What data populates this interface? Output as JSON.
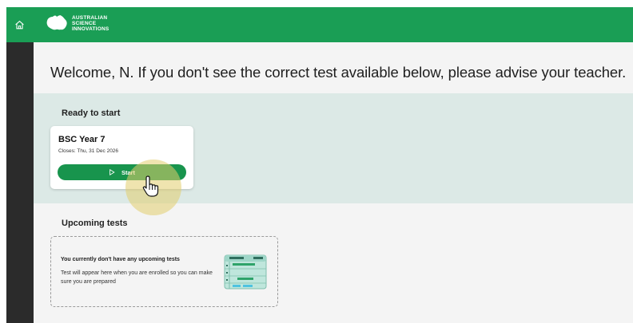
{
  "header": {
    "logo_text": "AUSTRALIAN\nSCIENCE\nINNOVATIONS",
    "brand_color": "#1a9e55",
    "home_icon": "home-icon"
  },
  "main": {
    "welcome": "Welcome, N. If you don't see the correct test available below, please advise your teacher."
  },
  "ready": {
    "title": "Ready to start",
    "card": {
      "title": "BSC Year 7",
      "closes": "Closes: Thu, 31 Dec 2026",
      "start_label": "Start",
      "start_icon": "play-icon"
    }
  },
  "upcoming": {
    "title": "Upcoming tests",
    "empty_title": "You currently don't have any upcoming tests",
    "empty_desc": "Test will appear here when you are enrolled so you can make sure you are prepared"
  },
  "colors": {
    "band": "#dce9e6",
    "button": "#18944d",
    "sidebar": "#2b2b2b"
  }
}
